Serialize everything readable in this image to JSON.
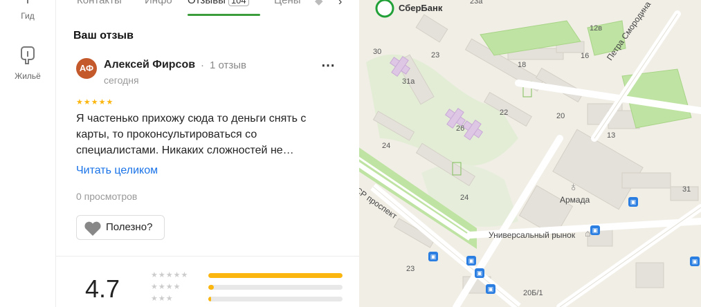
{
  "rail": {
    "items": [
      {
        "label": "Гид",
        "icon": "guide-icon"
      },
      {
        "label": "Жильё",
        "icon": "house-icon"
      }
    ]
  },
  "tabs": [
    {
      "label": "Контакты"
    },
    {
      "label": "Инфо"
    },
    {
      "label": "Отзывы",
      "count": "104",
      "active": true
    },
    {
      "label": "Цены"
    }
  ],
  "review": {
    "section_title": "Ваш отзыв",
    "avatar_initials": "АФ",
    "author": "Алексей Фирсов",
    "author_reviews": "1 отзыв",
    "date": "сегодня",
    "rating": 5,
    "stars": "★★★★★",
    "text": "Я частенько прихожу сюда то деньги снять с карты, то проконсультироваться со специалистами. Никаких сложностей не…",
    "read_more": "Читать целиком",
    "views": "0 просмотров",
    "helpful_label": "Полезно?"
  },
  "summary": {
    "rating": "4.7",
    "distribution": [
      {
        "stars": "★★★★★",
        "fraction": 1.0
      },
      {
        "stars": "★★★★",
        "fraction": 0.04
      },
      {
        "stars": "★★★",
        "fraction": 0.02
      }
    ]
  },
  "map": {
    "bank_name": "СберБанк",
    "poi_armada": "Армада",
    "poi_market": "Универсальный рынок",
    "street_smorodina": "Петра Смородина",
    "street_prospekt": "СР проспект",
    "house_numbers": [
      "23а",
      "12в",
      "30",
      "23",
      "18",
      "16",
      "31а",
      "22",
      "20",
      "26",
      "13",
      "24",
      "24",
      "31",
      "23",
      "20Б/1"
    ],
    "accent_green": "#3a9c3a",
    "link_color": "#1a73e8",
    "star_color": "#fbb60f",
    "bus_color": "#2a7de1"
  }
}
